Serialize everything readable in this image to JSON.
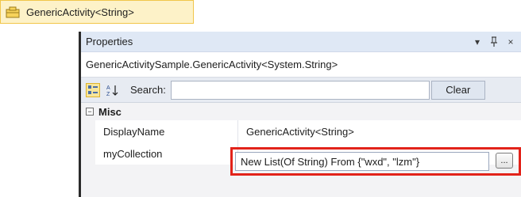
{
  "activity": {
    "label": "GenericActivity<String>",
    "icon": "activity-icon"
  },
  "properties": {
    "title": "Properties",
    "controls": {
      "dropdown": "▾",
      "pin": "ᵻ",
      "close": "×"
    },
    "object_name": "GenericActivitySample.GenericActivity<System.String>",
    "toolbar": {
      "search_label": "Search:",
      "search_value": "",
      "clear_label": "Clear"
    },
    "category": {
      "expander": "−",
      "name": "Misc"
    },
    "rows": [
      {
        "name": "DisplayName",
        "value": "GenericActivity<String>"
      },
      {
        "name": "myCollection",
        "value": "New List(Of String) From {\"wxd\", \"lzm\"}"
      }
    ],
    "ellipsis_label": "..."
  },
  "colors": {
    "highlight": "#e2231a",
    "chip_bg": "#fdf2c8",
    "header_bg": "#dfe8f5"
  }
}
